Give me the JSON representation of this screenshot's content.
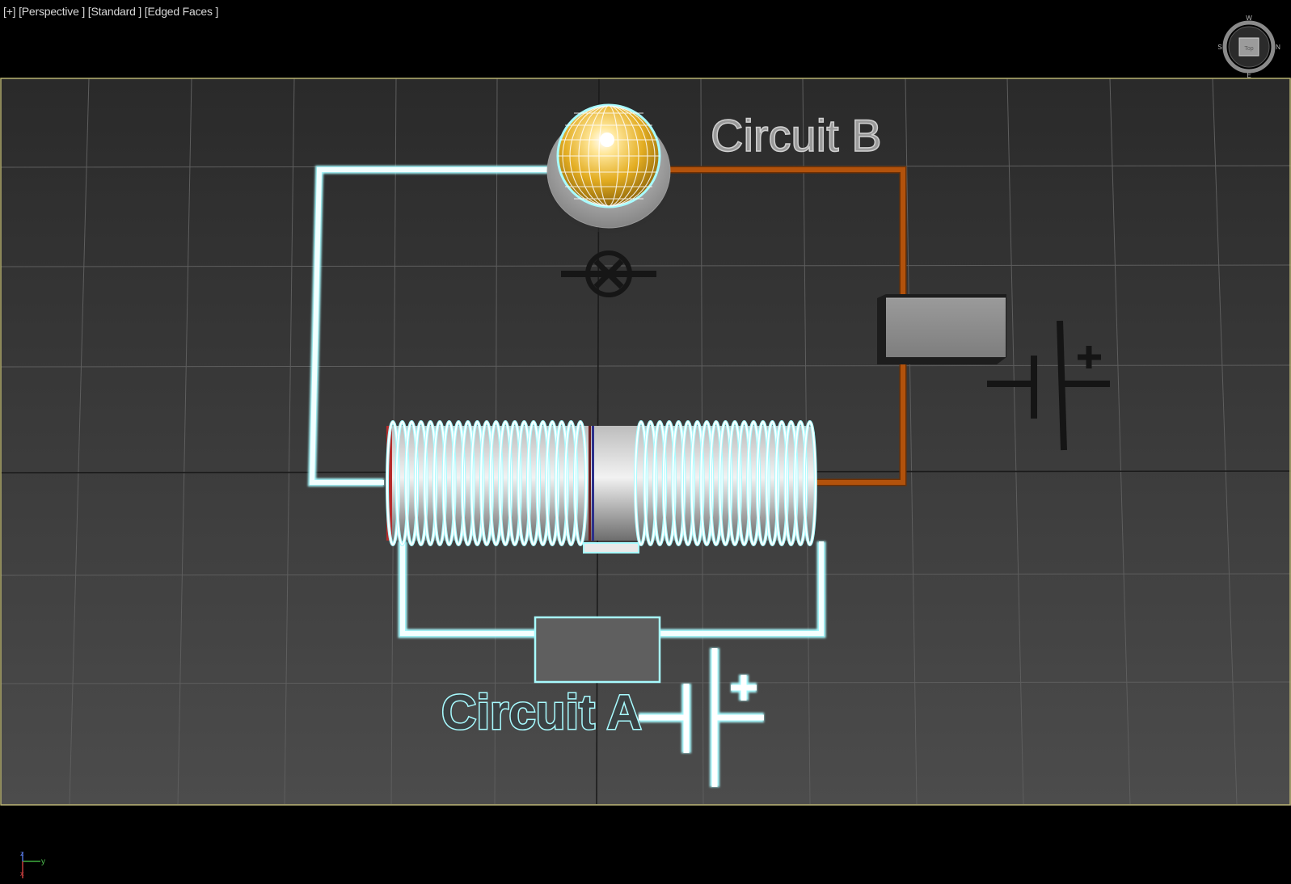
{
  "viewport": {
    "menu_plus": "[+]",
    "projection": "[Perspective ]",
    "shading": "[Standard ]",
    "display_mode": "[Edged Faces ]"
  },
  "scene": {
    "circuit_a_label": "Circuit A",
    "circuit_b_label": "Circuit B",
    "battery_plus": "+"
  },
  "viewcube": {
    "face_label": "Top",
    "compass": [
      "W",
      "N",
      "E",
      "S"
    ]
  },
  "axis_gizmo": {
    "axes": [
      "z",
      "y",
      "x"
    ]
  },
  "colors": {
    "background": "#000000",
    "grid_floor_top": "#2b2b2b",
    "grid_floor_bottom": "#4b4b4b",
    "grid_line": "#5c5c5c",
    "viewport_border": "#b8b272",
    "selection_highlight": "#a8fbff",
    "circuit_b_wire": "#b2520c",
    "bulb_glass": "#e8b52a",
    "battery_symbol_dark": "#151515"
  }
}
